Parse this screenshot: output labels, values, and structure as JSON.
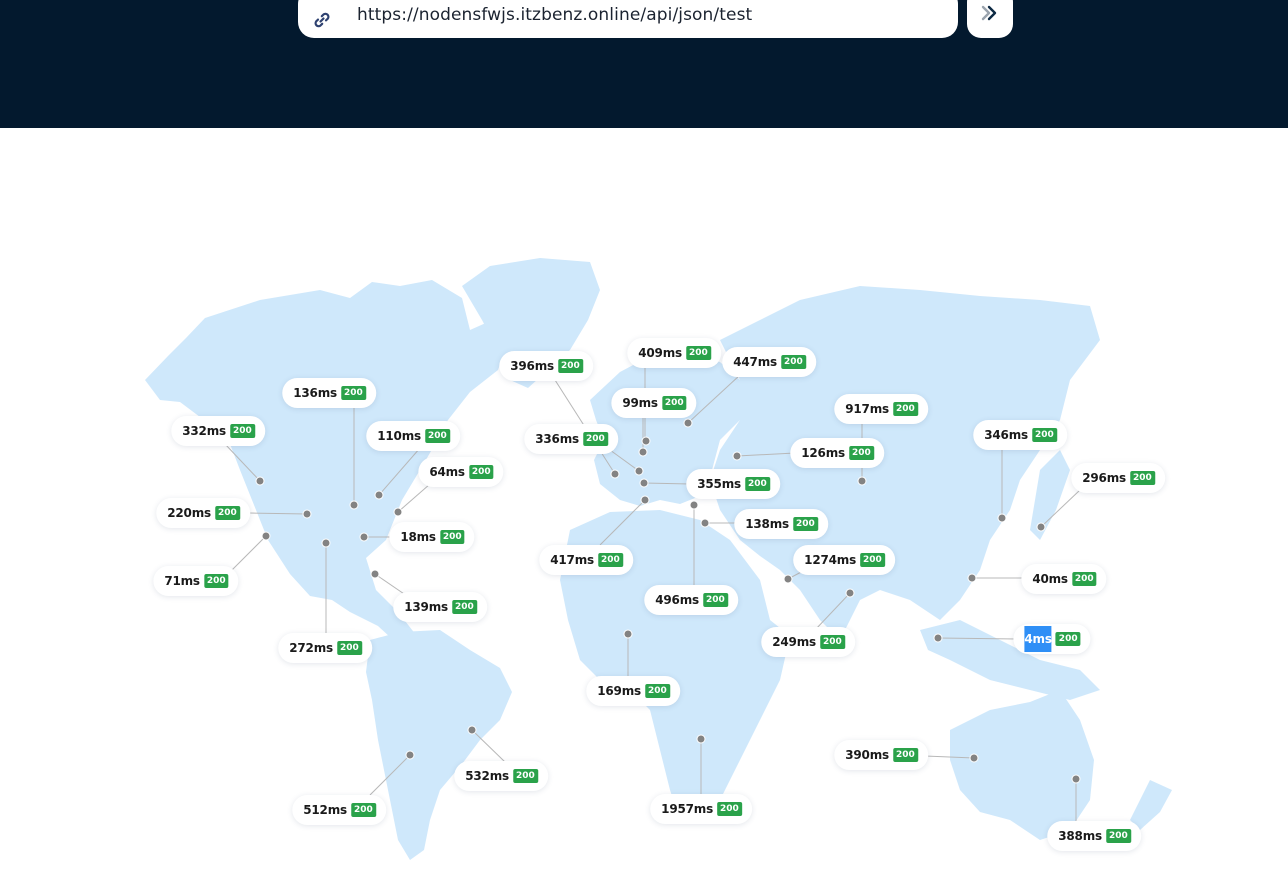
{
  "url_bar": {
    "link_icon": "link-icon",
    "url": "https://nodensfwjs.itzbenz.online/api/json/test",
    "go_icon": "double-chevron-right-icon"
  },
  "colors": {
    "header_bg": "#03192e",
    "land": "#cfe8fb",
    "pin": "#838383",
    "leader_line": "#b8b8b8",
    "status_ok": "#2aa24a",
    "selection": "#2f8ff6"
  },
  "locations": [
    {
      "ms": "332ms",
      "code": "200"
    },
    {
      "ms": "136ms",
      "code": "200"
    },
    {
      "ms": "110ms",
      "code": "200"
    },
    {
      "ms": "64ms",
      "code": "200"
    },
    {
      "ms": "220ms",
      "code": "200"
    },
    {
      "ms": "18ms",
      "code": "200"
    },
    {
      "ms": "71ms",
      "code": "200"
    },
    {
      "ms": "139ms",
      "code": "200"
    },
    {
      "ms": "272ms",
      "code": "200"
    },
    {
      "ms": "512ms",
      "code": "200"
    },
    {
      "ms": "532ms",
      "code": "200"
    },
    {
      "ms": "396ms",
      "code": "200"
    },
    {
      "ms": "409ms",
      "code": "200"
    },
    {
      "ms": "447ms",
      "code": "200"
    },
    {
      "ms": "99ms",
      "code": "200"
    },
    {
      "ms": "336ms",
      "code": "200"
    },
    {
      "ms": "355ms",
      "code": "200"
    },
    {
      "ms": "417ms",
      "code": "200"
    },
    {
      "ms": "138ms",
      "code": "200"
    },
    {
      "ms": "496ms",
      "code": "200"
    },
    {
      "ms": "169ms",
      "code": "200"
    },
    {
      "ms": "1957ms",
      "code": "200"
    },
    {
      "ms": "126ms",
      "code": "200"
    },
    {
      "ms": "917ms",
      "code": "200"
    },
    {
      "ms": "1274ms",
      "code": "200"
    },
    {
      "ms": "249ms",
      "code": "200"
    },
    {
      "ms": "346ms",
      "code": "200"
    },
    {
      "ms": "296ms",
      "code": "200"
    },
    {
      "ms": "40ms",
      "code": "200"
    },
    {
      "ms": "4ms",
      "code": "200",
      "selected": true
    },
    {
      "ms": "390ms",
      "code": "200"
    },
    {
      "ms": "388ms",
      "code": "200"
    }
  ]
}
